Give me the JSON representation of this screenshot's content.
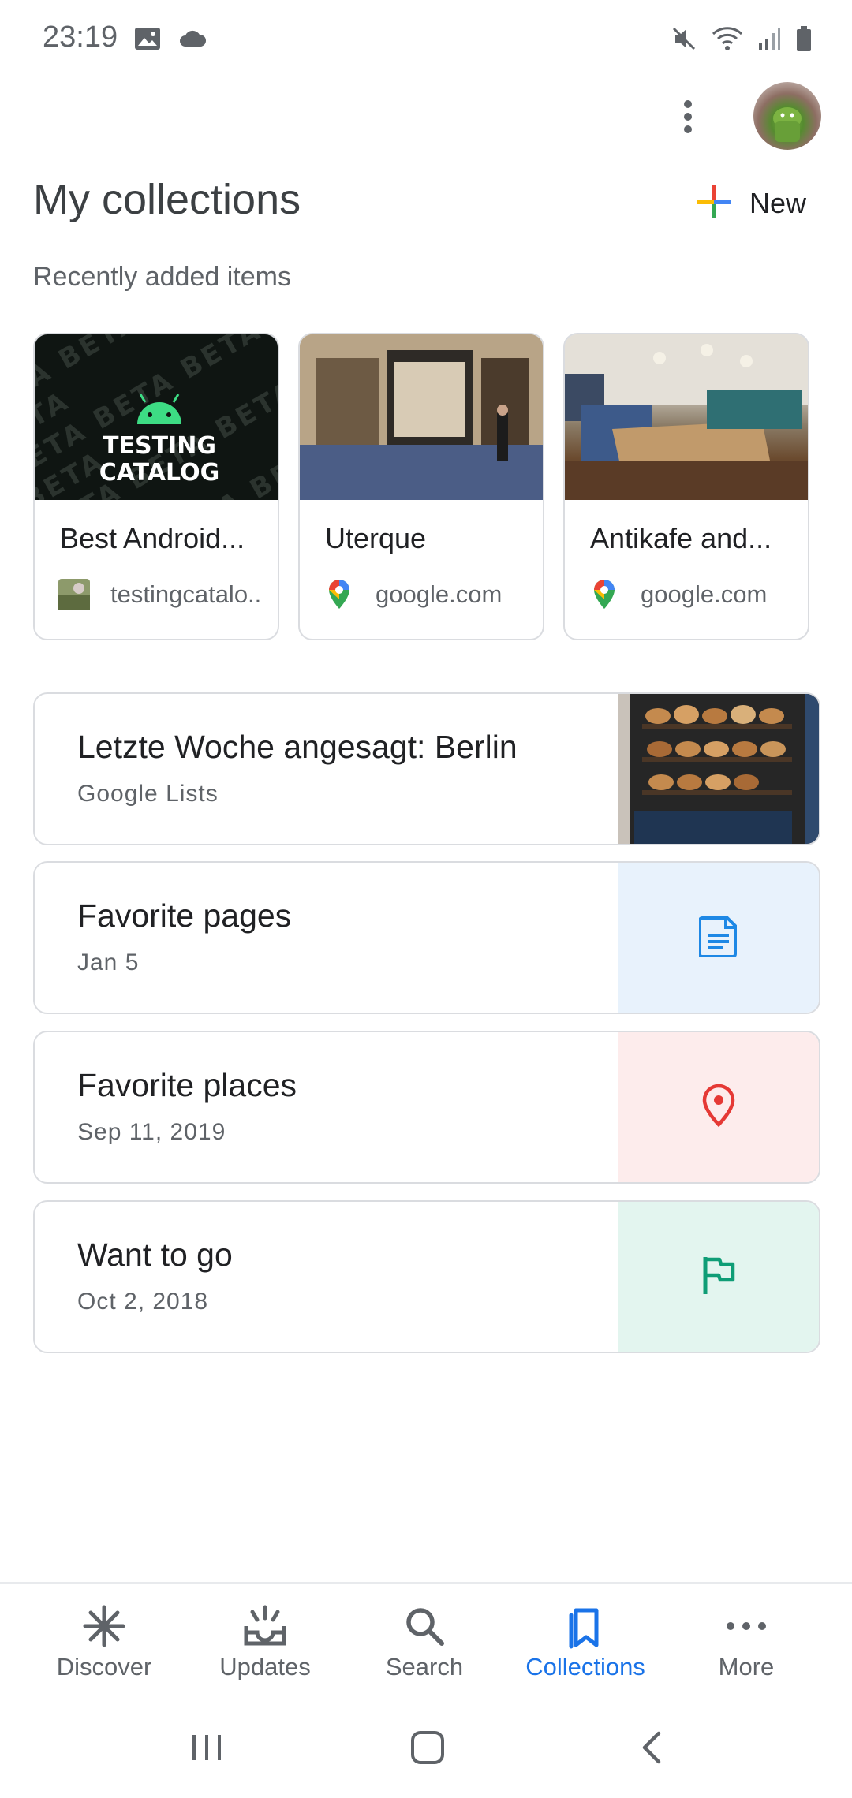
{
  "status_bar": {
    "time": "23:19",
    "left_icons": [
      "image-icon",
      "cloud-icon"
    ],
    "right_icons": [
      "mute-icon",
      "wifi-icon",
      "signal-icon",
      "battery-icon"
    ]
  },
  "header": {
    "overflow_icon": "more-vert-icon",
    "avatar": "avatar",
    "title": "My collections",
    "new_label": "New"
  },
  "recent": {
    "label": "Recently added items",
    "items": [
      {
        "title": "Best Android...",
        "source": "testingcatalo..",
        "source_icon": "site-favicon-icon"
      },
      {
        "title": "Uterque",
        "source": "google.com",
        "source_icon": "google-maps-pin-icon"
      },
      {
        "title": "Antikafe and...",
        "source": "google.com",
        "source_icon": "google-maps-pin-icon"
      }
    ],
    "beta_logo_lines": [
      "TESTING",
      "CATALOG"
    ]
  },
  "collections": [
    {
      "title": "Letzte Woche angesagt: Berlin",
      "subtitle": "Google Lists",
      "icon": "bakery-photo"
    },
    {
      "title": "Favorite pages",
      "subtitle": "Jan 5",
      "icon": "document-icon",
      "accent": "#1e88e5",
      "tint": "#e8f2fc"
    },
    {
      "title": "Favorite places",
      "subtitle": "Sep 11, 2019",
      "icon": "location-pin-icon",
      "accent": "#e53935",
      "tint": "#fdecec"
    },
    {
      "title": "Want to go",
      "subtitle": "Oct 2, 2018",
      "icon": "flag-icon",
      "accent": "#0f9d76",
      "tint": "#e3f5ef"
    }
  ],
  "bottom_nav": {
    "items": [
      {
        "label": "Discover",
        "icon": "asterisk-icon"
      },
      {
        "label": "Updates",
        "icon": "updates-tray-icon"
      },
      {
        "label": "Search",
        "icon": "search-icon"
      },
      {
        "label": "Collections",
        "icon": "bookmark-icon",
        "active": true
      },
      {
        "label": "More",
        "icon": "more-horiz-icon"
      }
    ],
    "active_color": "#1a73e8"
  },
  "system_nav": [
    "recents-icon",
    "home-icon",
    "back-icon"
  ]
}
